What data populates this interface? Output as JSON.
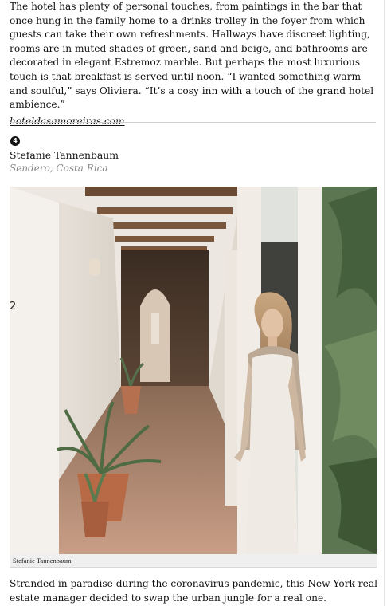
{
  "article": {
    "paragraph": "The hotel has plenty of personal touches, from paintings in the bar that once hung in the family home to a drinks trolley in the foyer from which guests can take their own refreshments. Hallways have discreet lighting, rooms are in muted shades of green, sand and beige, and bathrooms are decorated in elegant Estremoz marble. But perhaps the most luxurious touch is that breakfast is served until noon. “I wanted something warm and soulful,” says Oliviera. “It’s a cosy inn with a touch of the grand hotel ambience.”",
    "link": "hoteldasamoreiras.com"
  },
  "entry": {
    "number": "4",
    "name": "Stefanie Tannenbaum",
    "location": "Sendero, Costa Rica",
    "slide_number": "2",
    "photo_caption": "Stefanie Tannenbaum",
    "lead": "Stranded in paradise during the coronavirus pandemic, this New York real estate manager decided to swap the urban jungle for a real one."
  },
  "colors": {
    "wall": "#ebe6df",
    "terracotta": "#b86a47",
    "beam": "#6b4a33",
    "foliage": "#4f6b44",
    "dress": "#efebe4"
  }
}
